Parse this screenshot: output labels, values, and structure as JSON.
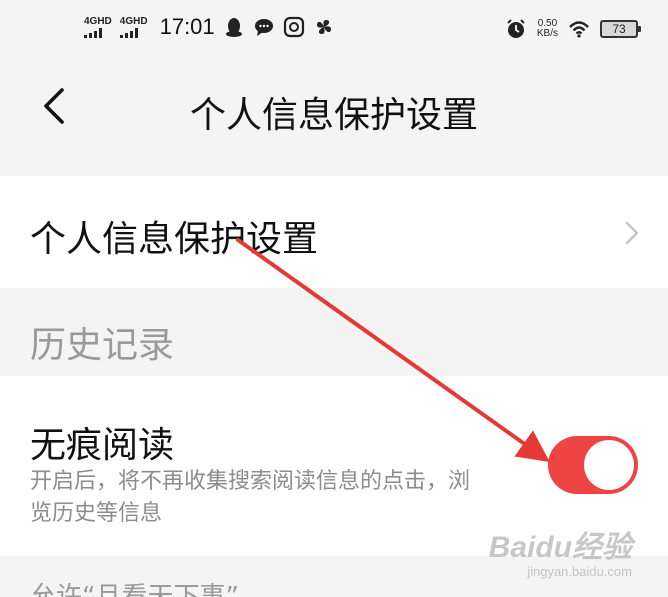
{
  "status_bar": {
    "network": [
      {
        "label": "4GHD"
      },
      {
        "label": "4GHD"
      }
    ],
    "time": "17:01",
    "icons": [
      "qq-penguin-icon",
      "chat-bubble-icon",
      "soul-app-icon",
      "pinwheel-icon"
    ],
    "alarm_icon": "alarm-icon",
    "net_speed_value": "0.50",
    "net_speed_unit": "KB/s",
    "wifi_icon": "wifi-icon",
    "battery": "73"
  },
  "header": {
    "back_icon": "back-chevron-icon",
    "title": "个人信息保护设置"
  },
  "settings_row": {
    "label": "个人信息保护设置",
    "chevron_icon": "chevron-right-icon"
  },
  "history_section": {
    "title": "历史记录"
  },
  "incognito": {
    "title": "无痕阅读",
    "description": "开启后，将不再收集搜索阅读信息的点击，浏览历史等信息",
    "enabled": true,
    "accent": "#ef4444"
  },
  "next_section": {
    "title": "允许“且看天下事”"
  },
  "annotation": {
    "color": "#e53935"
  },
  "watermark": {
    "logo": "Baidu经验",
    "url": "jingyan.baidu.com"
  }
}
